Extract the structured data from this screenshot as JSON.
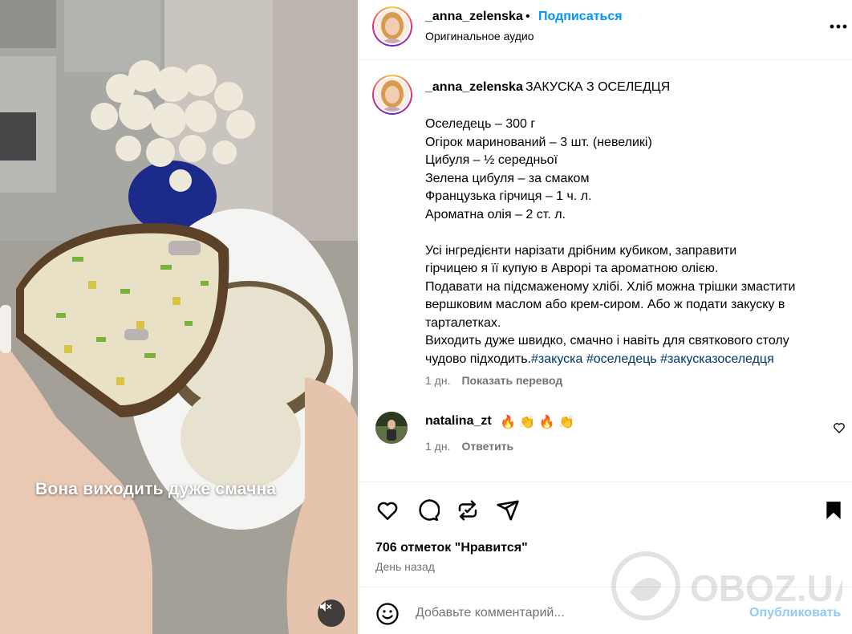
{
  "media": {
    "caption": "Вона виходить дуже смачна",
    "mute_icon": "speaker-muted-icon"
  },
  "header": {
    "username": "_anna_zelenska",
    "separator": "•",
    "follow_label": "Подписаться",
    "audio_label": "Оригинальное аудио",
    "more_icon": "more-options-icon"
  },
  "caption": {
    "username": "_anna_zelenska",
    "title": "ЗАКУСКА З ОСЕЛЕДЦЯ",
    "ingredients": [
      "Оселедець – 300 г",
      "Огірок маринований – 3 шт. (невеликі)",
      "Цибуля – ½ середньої",
      "Зелена цибуля – за смаком",
      "Французька гірчиця – 1 ч. л.",
      "Ароматна олія – 2 ст. л."
    ],
    "instructions": [
      "Усі інгредієнти нарізати дрібним кубиком, заправити",
      "гірчицею я її купую в Аврорі та ароматною олією.",
      "Подавати на підсмаженому хлібі. Хліб можна трішки змастити",
      "вершковим маслом або крем-сиром. Або ж подати закуску в",
      "тарталетках.",
      "Виходить дуже швидко, смачно і навіть для святкового столу"
    ],
    "last_line_text": "чудово підходить.",
    "hashtags": "#закуска #оселедець #закусказоселедця",
    "time": "1 дн.",
    "translate_label": "Показать перевод"
  },
  "comment": {
    "username": "natalina_zt",
    "text": "🔥 👏 🔥 👏",
    "time": "1 дн.",
    "reply_label": "Ответить"
  },
  "actions": {
    "icons": [
      "heart-icon",
      "comment-icon",
      "repost-icon",
      "share-icon",
      "bookmark-icon"
    ],
    "likes": "706 отметок \"Нравится\"",
    "posted": "День назад"
  },
  "comment_bar": {
    "placeholder": "Добавьте комментарий...",
    "post_label": "Опубликовать"
  },
  "watermark": "OBOZ.UA",
  "colors": {
    "accent": "#0095f6",
    "hashtag": "#00376b",
    "muted_text": "#737373",
    "post_disabled": "#93c9f7"
  }
}
